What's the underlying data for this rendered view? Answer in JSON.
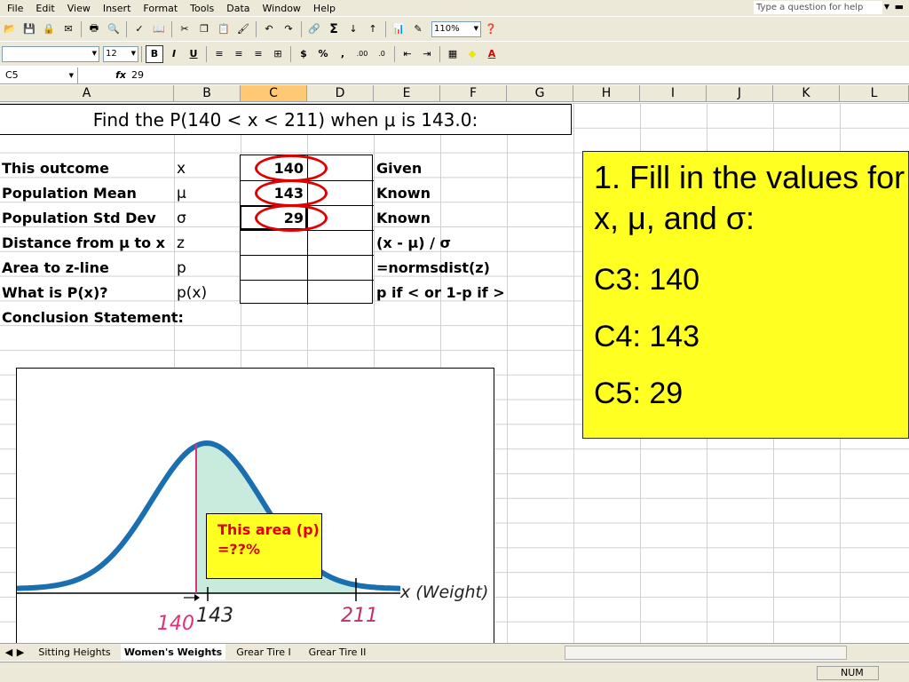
{
  "menu": [
    "File",
    "Edit",
    "View",
    "Insert",
    "Format",
    "Tools",
    "Data",
    "Window",
    "Help"
  ],
  "help_placeholder": "Type a question for help",
  "zoom": "110%",
  "font_size": "12",
  "formula_bar": {
    "name_box": "C5",
    "fx": "fx",
    "value": "29"
  },
  "columns": [
    "A",
    "B",
    "C",
    "D",
    "E",
    "F",
    "G",
    "H",
    "I",
    "J",
    "K",
    "L"
  ],
  "title": "Find the P(140 < x < 211) when μ is 143.0:",
  "rows": [
    {
      "label": "This outcome",
      "symbol": "x",
      "value": "140",
      "note": "Given"
    },
    {
      "label": "Population Mean",
      "symbol": "μ",
      "value": "143",
      "note": "Known"
    },
    {
      "label": "Population Std Dev",
      "symbol": "σ",
      "value": "29",
      "note": "Known"
    },
    {
      "label": "Distance from μ to x",
      "symbol": "z",
      "value": "",
      "note": "(x - μ) / σ"
    },
    {
      "label": "Area to z-line",
      "symbol": "p",
      "value": "",
      "note": "=normsdist(z)"
    },
    {
      "label": "What is P(x)?",
      "symbol": "p(x)",
      "value": "",
      "note": "p if  < or 1-p if  >"
    },
    {
      "label": "Conclusion Statement:",
      "symbol": "",
      "value": "",
      "note": ""
    }
  ],
  "instruction": {
    "heading": "1. Fill in the values for x, μ, and σ:",
    "lines": [
      "C3: 140",
      "C4: 143",
      "C5: 29"
    ]
  },
  "chart": {
    "callout": "This area (p) =??%",
    "axis_label": "x (Weight)",
    "labels": {
      "left": "140",
      "mean": "143",
      "right": "211"
    },
    "colors": {
      "curve": "#1a6fb0",
      "fill": "#c8ebdd",
      "left_line": "#e0307a",
      "left_label": "#e0307a",
      "right_label": "#c0306a"
    }
  },
  "tabs": [
    "Sitting Heights",
    "Women's Weights",
    "Grear Tire I",
    "Grear Tire II"
  ],
  "status": {
    "num": "NUM"
  }
}
